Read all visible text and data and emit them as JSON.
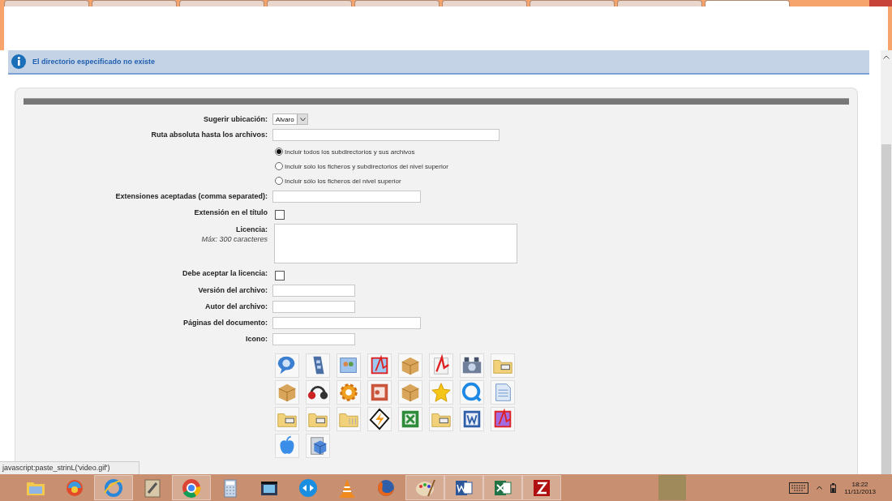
{
  "browser": {
    "tabs": [
      {
        "selected": false
      },
      {
        "selected": false
      },
      {
        "selected": false
      },
      {
        "selected": false
      },
      {
        "selected": false
      },
      {
        "selected": false
      },
      {
        "selected": false
      },
      {
        "selected": false
      },
      {
        "selected": true
      }
    ]
  },
  "message": {
    "text": "El directorio especificado no existe"
  },
  "form": {
    "fields": [
      {
        "kind": "select",
        "label": "Sugerir ubicación:",
        "value": "Alvaro"
      },
      {
        "kind": "longtext",
        "label": "Ruta absoluta hasta los archivos:"
      },
      {
        "kind": "radio",
        "options": [
          {
            "label": "Incluir todos los subdirectorios y sus archivos",
            "selected": true
          },
          {
            "label": "Incluir solo los ficheros y subdirectorios del nivel superior",
            "selected": false
          },
          {
            "label": "Incluir sólo los ficheros del nivel superior",
            "selected": false
          }
        ]
      },
      {
        "kind": "text",
        "label": "Extensiones aceptadas (comma separated):"
      },
      {
        "kind": "checkbox",
        "label": "Extensión en el título",
        "checked": false
      },
      {
        "kind": "textarea",
        "label": "Licencia:",
        "note": "Máx: 300 caracteres"
      },
      {
        "kind": "checkbox",
        "label": "Debe aceptar la licencia:",
        "checked": false
      },
      {
        "kind": "shorttext",
        "label": "Versión del archivo:"
      },
      {
        "kind": "shorttext",
        "label": "Autor del archivo:"
      },
      {
        "kind": "text",
        "label": "Páginas del documento:"
      },
      {
        "kind": "shorttext",
        "label": "Icono:"
      },
      {
        "kind": "icons"
      }
    ]
  },
  "status_text": "javascript:paste_strinL('video.gif')",
  "taskbar": {
    "apps": [
      {
        "running": false
      },
      {
        "running": false
      },
      {
        "running": true
      },
      {
        "running": false
      },
      {
        "running": true
      },
      {
        "running": false
      },
      {
        "running": false
      },
      {
        "running": false
      },
      {
        "running": false
      },
      {
        "running": false
      },
      {
        "running": true
      },
      {
        "running": true
      },
      {
        "running": true
      },
      {
        "running": true
      }
    ],
    "time": "18:22",
    "date": "11/11/2013"
  }
}
